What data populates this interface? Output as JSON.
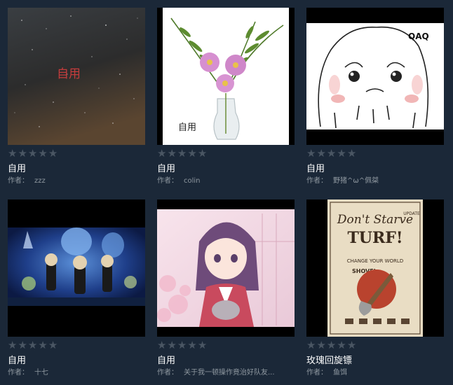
{
  "author_label": "作者：",
  "star_glyph": "★",
  "items": [
    {
      "title": "自用",
      "author": "zzz",
      "thumb_text": "自用",
      "thumb_icon": "starry-sky-image"
    },
    {
      "title": "自用",
      "author": "colin",
      "thumb_text": "自用",
      "thumb_icon": "flower-vase-image"
    },
    {
      "title": "自用",
      "author": "野猪^ω^佩桀",
      "thumb_text": "QAQ",
      "thumb_icon": "crying-bunny-image"
    },
    {
      "title": "自用",
      "author": "十七",
      "thumb_text": "",
      "thumb_icon": "dont-starve-characters-image"
    },
    {
      "title": "自用",
      "author": "关于我一顿操作竟治好队友...",
      "thumb_text": "",
      "thumb_icon": "anime-girl-image"
    },
    {
      "title": "玫瑰回旋镖",
      "author": "鱼饵",
      "thumb_text": "Dont Starve TURF! UPDATE",
      "thumb_icon": "dont-starve-turf-poster-image"
    }
  ],
  "colors": {
    "background": "#1b2838",
    "star_empty": "#4a5663",
    "title": "#ffffff",
    "author": "#8f98a0"
  }
}
